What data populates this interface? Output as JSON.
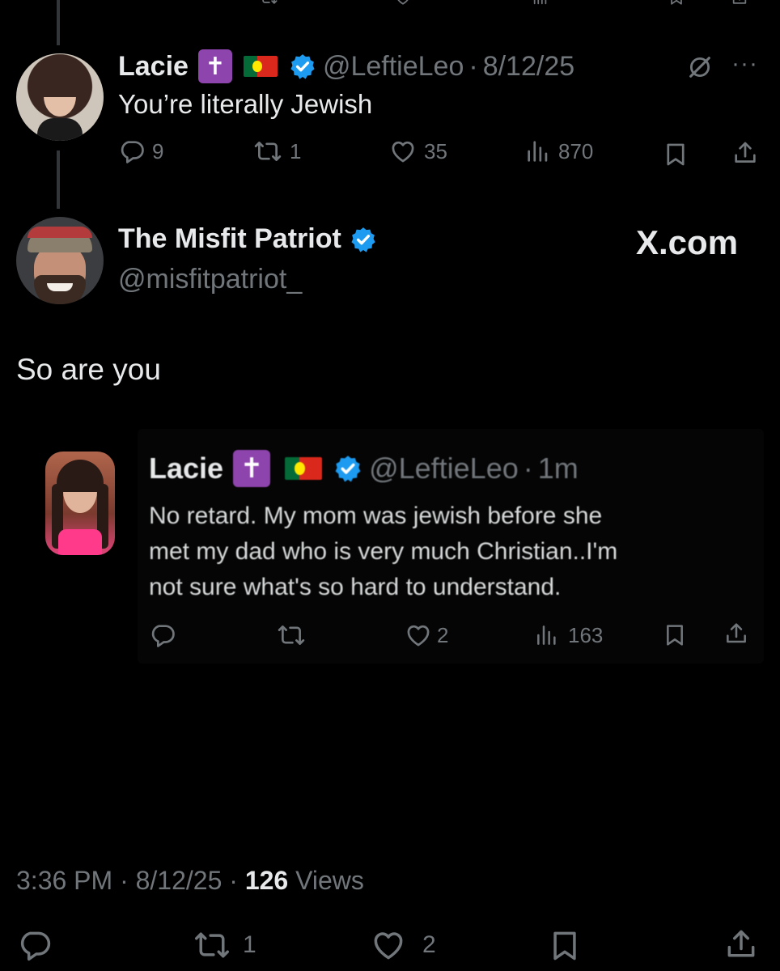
{
  "parent_tweet": {
    "name": "Lacie",
    "badge_symbol": "✝",
    "handle": "@LeftieLeo",
    "date": "8/12/25",
    "text": "You’re literally Jewish",
    "replies": "9",
    "reposts": "1",
    "likes": "35",
    "views": "870",
    "more_label": "···"
  },
  "main_tweet": {
    "name": "The Misfit Patriot",
    "handle": "@misfitpatriot_",
    "watermark": "X.com",
    "text": "So are you",
    "time": "3:36 PM",
    "date": "8/12/25",
    "views_count": "126",
    "views_label": "Views",
    "reposts": "1",
    "likes": "2"
  },
  "embedded_tweet": {
    "name": "Lacie",
    "badge_symbol": "✝",
    "handle": "@LeftieLeo",
    "time": "1m",
    "text_lines": [
      "No retard. My mom was jewish before she",
      "met my dad who is very much Christian..I'm",
      "not sure what's so hard to understand."
    ],
    "likes": "2",
    "views": "163"
  },
  "colors": {
    "background": "#000000",
    "text": "#e7e9ea",
    "muted": "#71767b",
    "verified": "#1d9bf0",
    "badge": "#8e44ad"
  },
  "icons": [
    "reply-icon",
    "repost-icon",
    "like-icon",
    "views-icon",
    "bookmark-icon",
    "share-icon",
    "grok-icon",
    "verified-icon",
    "cross-icon",
    "portugal-flag-icon"
  ]
}
